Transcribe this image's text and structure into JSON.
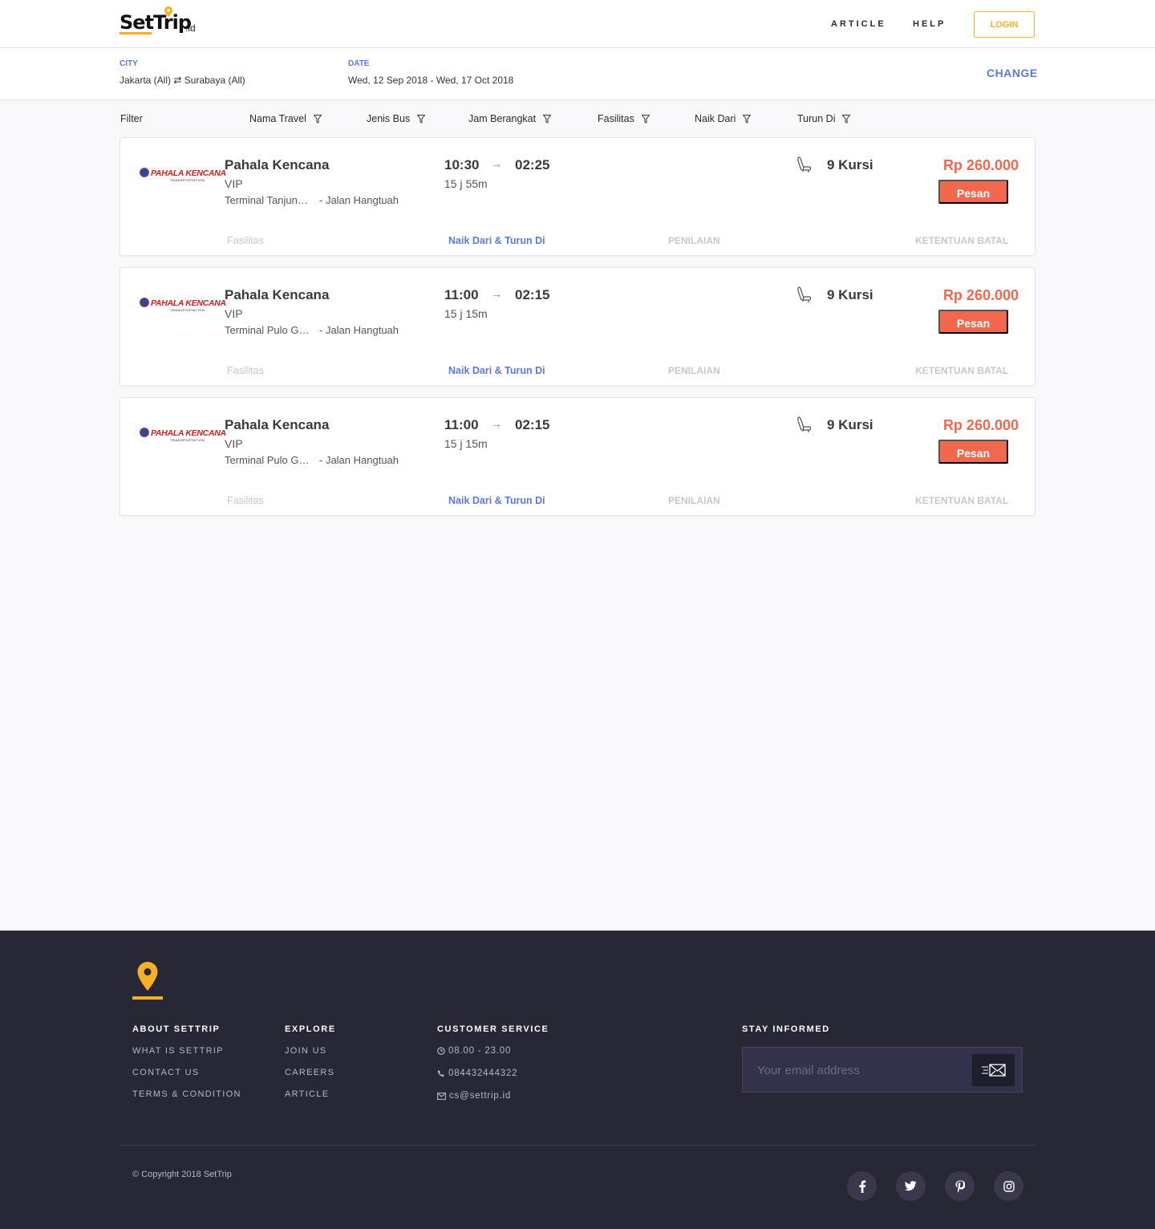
{
  "header": {
    "logo_text_set": "Set",
    "logo_text_trip": "Trip",
    "logo_suffix": ".id",
    "nav": [
      "ARTICLE",
      "HELP"
    ],
    "login_label": "LOGIN"
  },
  "summary": {
    "city_label": "CITY",
    "city_from": "Jakarta (All)",
    "city_swap": "⇄",
    "city_to": "Surabaya (All)",
    "date_label": "DATE",
    "date_value": "Wed, 12 Sep 2018 - Wed, 17 Oct 2018",
    "change_label": "CHANGE"
  },
  "filters": {
    "title": "Filter",
    "items": [
      "Nama Travel",
      "Jenis Bus",
      "Jam Berangkat",
      "Fasilitas",
      "Naik Dari",
      "Turun Di"
    ]
  },
  "results": [
    {
      "logo_text": "PAHALA KENCANA",
      "logo_sub": "TRANSPORTATION",
      "operator": "Pahala Kencana",
      "bus_class": "VIP",
      "from": "Terminal Tanjung Priok",
      "to": "- Jalan Hangtuah",
      "departure": "10:30",
      "arrow": "→",
      "arrival": "02:25",
      "duration": "15 j 55m",
      "seats": "9 Kursi",
      "price": "Rp 260.000",
      "book_label": "Pesan",
      "tabs": [
        "Fasilitas",
        "Naik Dari & Turun Di",
        "PENILAIAN",
        "KETENTUAN BATAL"
      ]
    },
    {
      "logo_text": "PAHALA KENCANA",
      "logo_sub": "TRANSPORTATION",
      "operator": "Pahala Kencana",
      "bus_class": "VIP",
      "from": "Terminal Pulo Gebang",
      "to": "- Jalan Hangtuah",
      "departure": "11:00",
      "arrow": "→",
      "arrival": "02:15",
      "duration": "15 j 15m",
      "seats": "9 Kursi",
      "price": "Rp 260.000",
      "book_label": "Pesan",
      "tabs": [
        "Fasilitas",
        "Naik Dari & Turun Di",
        "PENILAIAN",
        "KETENTUAN BATAL"
      ]
    },
    {
      "logo_text": "PAHALA KENCANA",
      "logo_sub": "TRANSPORTATION",
      "operator": "Pahala Kencana",
      "bus_class": "VIP",
      "from": "Terminal Pulo Gebang",
      "to": "- Jalan Hangtuah",
      "departure": "11:00",
      "arrow": "→",
      "arrival": "02:15",
      "duration": "15 j 15m",
      "seats": "9 Kursi",
      "price": "Rp 260.000",
      "book_label": "Pesan",
      "tabs": [
        "Fasilitas",
        "Naik Dari & Turun Di",
        "PENILAIAN",
        "KETENTUAN BATAL"
      ]
    }
  ],
  "footer": {
    "about": {
      "title": "ABOUT SETTRIP",
      "links": [
        "WHAT IS SETTRIP",
        "CONTACT US",
        "TERMS & CONDITION"
      ]
    },
    "explore": {
      "title": "EXPLORE",
      "links": [
        "JOIN US",
        "CAREERS",
        "ARTICLE"
      ]
    },
    "customer_service": {
      "title": "CUSTOMER SERVICE",
      "hours": "08.00 - 23.00",
      "phone": "084432444322",
      "email": "cs@settrip.id"
    },
    "stay_informed": {
      "title": "STAY INFORMED",
      "placeholder": "Your email address"
    },
    "copyright": "© Copyright 2018 SetTrip",
    "social_icons": [
      "facebook-icon",
      "twitter-icon",
      "pinterest-icon",
      "instagram-icon"
    ]
  },
  "colors": {
    "accent_orange": "#f6b026",
    "primary_blue": "#5a7ae0",
    "price_red": "#f2684e",
    "footer_bg": "#282736"
  }
}
